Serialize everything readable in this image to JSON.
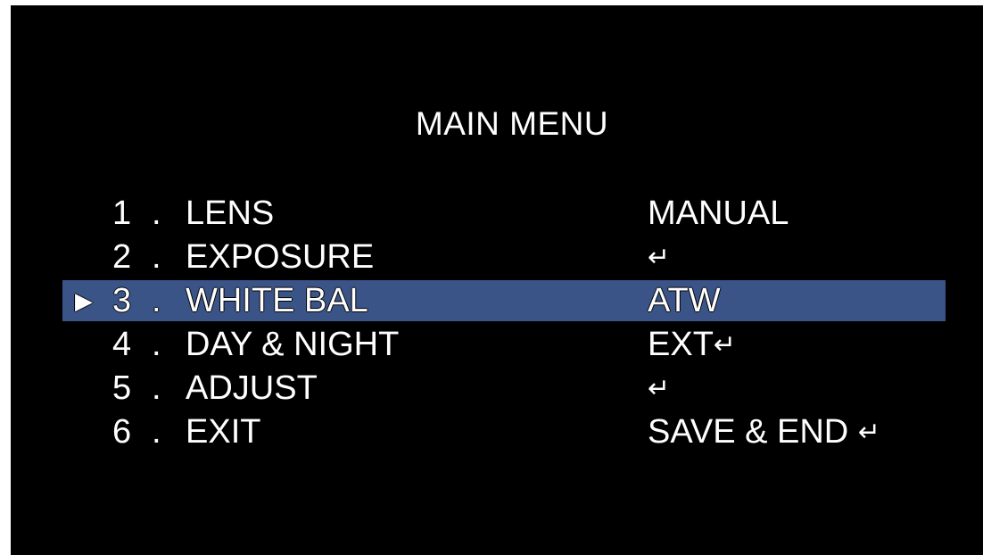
{
  "title": "MAIN MENU",
  "cursor_glyph": "▶",
  "enter_glyph": "↵",
  "highlight_color": "#3a5487",
  "items": [
    {
      "number": "1",
      "dot": ".",
      "label": "LENS",
      "value": "MANUAL",
      "enter": ""
    },
    {
      "number": "2",
      "dot": ".",
      "label": "EXPOSURE",
      "value": "",
      "enter": "↵"
    },
    {
      "number": "3",
      "dot": ".",
      "label": "WHITE BAL",
      "value": "ATW",
      "enter": ""
    },
    {
      "number": "4",
      "dot": ".",
      "label": "DAY & NIGHT",
      "value": "EXT",
      "enter": "↵"
    },
    {
      "number": "5",
      "dot": ".",
      "label": "ADJUST",
      "value": "",
      "enter": "↵"
    },
    {
      "number": "6",
      "dot": ".",
      "label": "EXIT",
      "value": "SAVE & END ",
      "enter": "↵"
    }
  ],
  "selected_index": 2
}
